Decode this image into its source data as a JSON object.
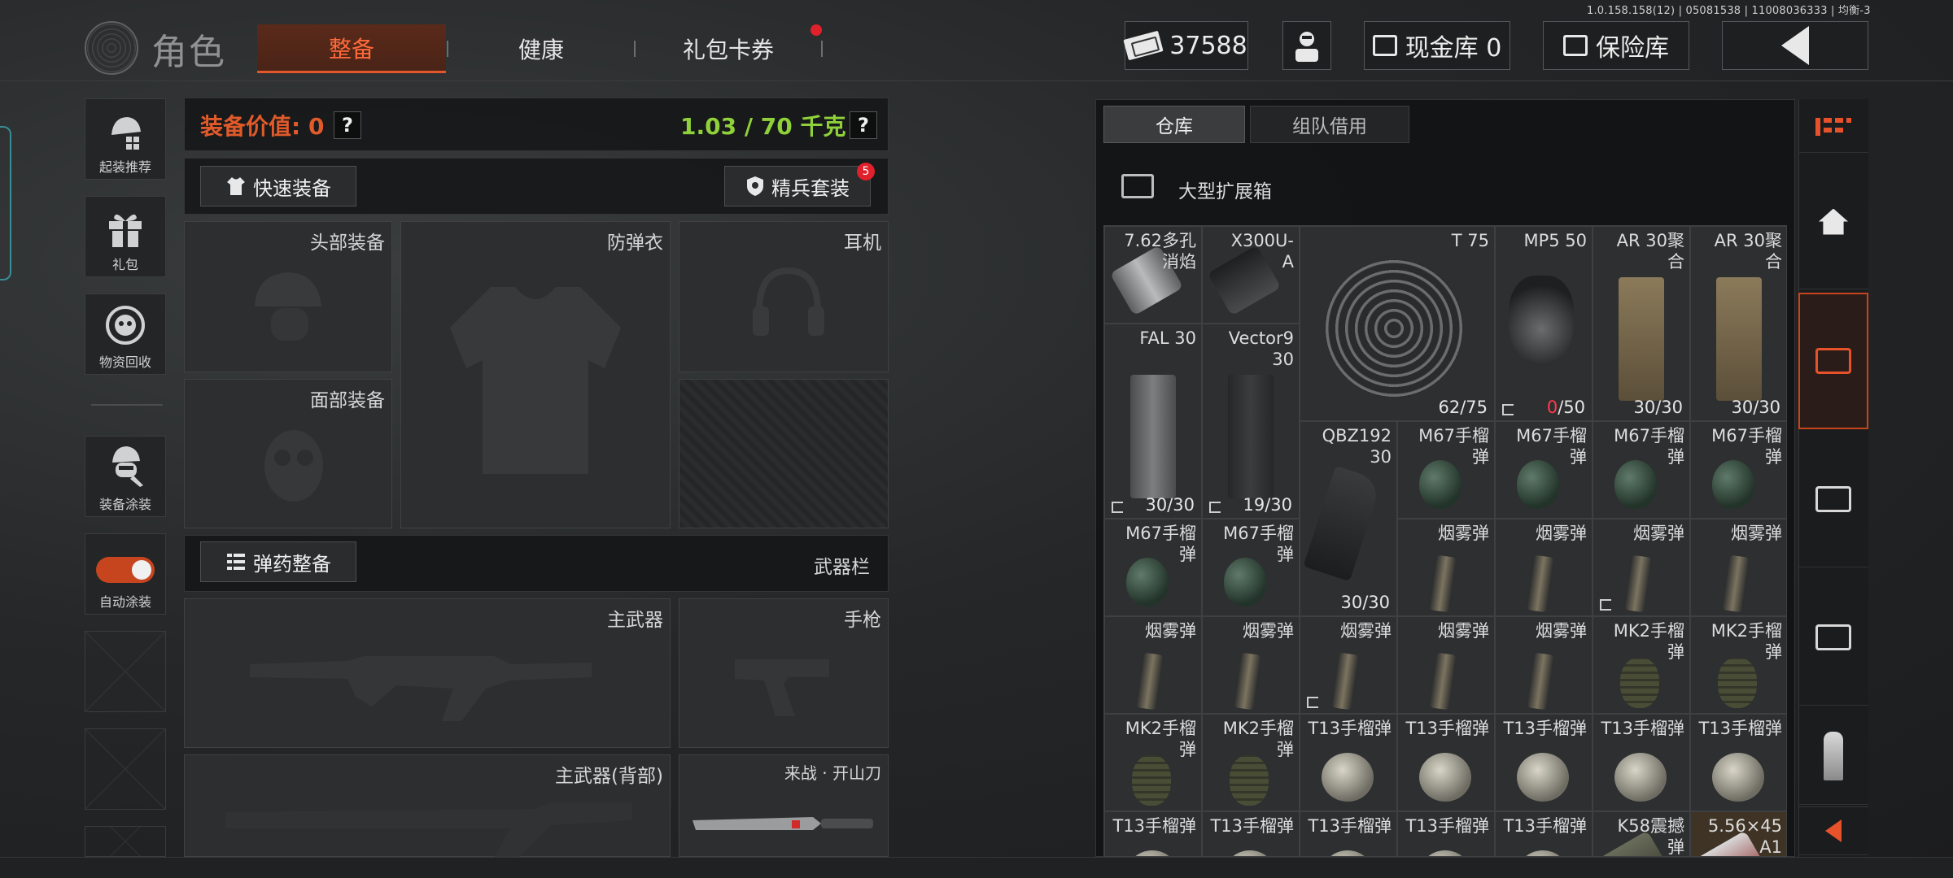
{
  "version": "1.0.158.158(12) | 05081538 | 11008036333 | 均衡-3",
  "header": {
    "title": "角色",
    "tabs": [
      {
        "label": "整备",
        "active": true
      },
      {
        "label": "健康",
        "active": false
      },
      {
        "label": "礼包卡券",
        "active": false,
        "has_notification": true
      }
    ],
    "money": "37588",
    "cash_vault": "现金库 0",
    "insurance": "保险库"
  },
  "sidebar": {
    "items": [
      {
        "label": "起装推荐",
        "icon": "helmet-grid-icon"
      },
      {
        "label": "礼包",
        "icon": "gift-icon"
      },
      {
        "label": "物资回收",
        "icon": "recycle-icon"
      },
      {
        "label": "装备涂装",
        "icon": "soldier-paint-icon"
      },
      {
        "label": "自动涂装",
        "icon": "toggle-icon",
        "toggle_on": true
      }
    ]
  },
  "equipment": {
    "value_label": "装备价值: 0",
    "weight": "1.03 / 70 千克",
    "help_symbol": "?",
    "quick_equip": "快速装备",
    "elite_set": "精兵套装",
    "elite_badge": "5",
    "slots": {
      "head": "头部装备",
      "armor": "防弹衣",
      "headset": "耳机",
      "face": "面部装备",
      "primary": "主武器",
      "pistol": "手枪",
      "primary_back": "主武器(背部)",
      "melee": "来战 · 开山刀"
    },
    "ammo_button": "弹药整备",
    "weapon_bar": "武器栏"
  },
  "storage": {
    "tabs": [
      {
        "label": "仓库",
        "active": true
      },
      {
        "label": "组队借用",
        "active": false
      }
    ],
    "container": "大型扩展箱",
    "items": [
      {
        "name": "7.62多孔\n消焰",
        "art": "muzzle",
        "col": 0,
        "row": 0,
        "w": 1,
        "h": 1
      },
      {
        "name": "X300U-\nA",
        "art": "light",
        "col": 1,
        "row": 0,
        "w": 1,
        "h": 1
      },
      {
        "name": "T 75",
        "count": "62/75",
        "art": "drum",
        "col": 2,
        "row": 0,
        "w": 2,
        "h": 2
      },
      {
        "name": "MP5 50",
        "count_red": "0",
        "count_rest": "/50",
        "flag": true,
        "art": "drum-small",
        "col": 4,
        "row": 0,
        "w": 1,
        "h": 2
      },
      {
        "name": "AR 30聚\n合",
        "count": "30/30",
        "art": "mag-tan",
        "col": 5,
        "row": 0,
        "w": 1,
        "h": 2
      },
      {
        "name": "AR 30聚\n合",
        "count": "30/30",
        "art": "mag-tan",
        "col": 6,
        "row": 0,
        "w": 1,
        "h": 2
      },
      {
        "name": "FAL 30",
        "count": "30/30",
        "flag": true,
        "art": "mag-steel",
        "col": 0,
        "row": 1,
        "w": 1,
        "h": 2
      },
      {
        "name": "Vector9\n30",
        "count": "19/30",
        "flag": true,
        "art": "mag-dark",
        "col": 1,
        "row": 1,
        "w": 1,
        "h": 2
      },
      {
        "name": "QBZ192\n30",
        "count": "30/30",
        "art": "mag-curve",
        "col": 2,
        "row": 2,
        "w": 1,
        "h": 2
      },
      {
        "name": "M67手榴\n弹",
        "art": "grenade",
        "col": 3,
        "row": 2,
        "w": 1,
        "h": 1
      },
      {
        "name": "M67手榴\n弹",
        "art": "grenade",
        "col": 4,
        "row": 2,
        "w": 1,
        "h": 1
      },
      {
        "name": "M67手榴\n弹",
        "art": "grenade",
        "col": 5,
        "row": 2,
        "w": 1,
        "h": 1
      },
      {
        "name": "M67手榴\n弹",
        "art": "grenade",
        "col": 6,
        "row": 2,
        "w": 1,
        "h": 1
      },
      {
        "name": "M67手榴\n弹",
        "art": "grenade",
        "col": 0,
        "row": 3,
        "w": 1,
        "h": 1
      },
      {
        "name": "M67手榴\n弹",
        "art": "grenade",
        "col": 1,
        "row": 3,
        "w": 1,
        "h": 1
      },
      {
        "name": "烟雾弹",
        "art": "smoke",
        "col": 3,
        "row": 3,
        "w": 1,
        "h": 1
      },
      {
        "name": "烟雾弹",
        "art": "smoke",
        "col": 4,
        "row": 3,
        "w": 1,
        "h": 1
      },
      {
        "name": "烟雾弹",
        "flag": true,
        "art": "smoke",
        "col": 5,
        "row": 3,
        "w": 1,
        "h": 1
      },
      {
        "name": "烟雾弹",
        "art": "smoke",
        "col": 6,
        "row": 3,
        "w": 1,
        "h": 1
      },
      {
        "name": "烟雾弹",
        "art": "smoke",
        "col": 0,
        "row": 4,
        "w": 1,
        "h": 1
      },
      {
        "name": "烟雾弹",
        "art": "smoke",
        "col": 1,
        "row": 4,
        "w": 1,
        "h": 1
      },
      {
        "name": "烟雾弹",
        "flag": true,
        "art": "smoke",
        "col": 2,
        "row": 4,
        "w": 1,
        "h": 1
      },
      {
        "name": "烟雾弹",
        "art": "smoke",
        "col": 3,
        "row": 4,
        "w": 1,
        "h": 1
      },
      {
        "name": "烟雾弹",
        "art": "smoke",
        "col": 4,
        "row": 4,
        "w": 1,
        "h": 1
      },
      {
        "name": "MK2手榴\n弹",
        "art": "mk2",
        "col": 5,
        "row": 4,
        "w": 1,
        "h": 1
      },
      {
        "name": "MK2手榴\n弹",
        "art": "mk2",
        "col": 6,
        "row": 4,
        "w": 1,
        "h": 1
      },
      {
        "name": "MK2手榴\n弹",
        "art": "mk2",
        "col": 0,
        "row": 5,
        "w": 1,
        "h": 1
      },
      {
        "name": "MK2手榴\n弹",
        "art": "mk2",
        "col": 1,
        "row": 5,
        "w": 1,
        "h": 1
      },
      {
        "name": "T13手榴弹",
        "art": "t13",
        "col": 2,
        "row": 5,
        "w": 1,
        "h": 1
      },
      {
        "name": "T13手榴弹",
        "art": "t13",
        "col": 3,
        "row": 5,
        "w": 1,
        "h": 1
      },
      {
        "name": "T13手榴弹",
        "art": "t13",
        "col": 4,
        "row": 5,
        "w": 1,
        "h": 1
      },
      {
        "name": "T13手榴弹",
        "art": "t13",
        "col": 5,
        "row": 5,
        "w": 1,
        "h": 1
      },
      {
        "name": "T13手榴弹",
        "art": "t13",
        "col": 6,
        "row": 5,
        "w": 1,
        "h": 1
      },
      {
        "name": "T13手榴弹",
        "art": "t13",
        "col": 0,
        "row": 6,
        "w": 1,
        "h": 1
      },
      {
        "name": "T13手榴弹",
        "art": "t13",
        "col": 1,
        "row": 6,
        "w": 1,
        "h": 1
      },
      {
        "name": "T13手榴弹",
        "art": "t13",
        "col": 2,
        "row": 6,
        "w": 1,
        "h": 1
      },
      {
        "name": "T13手榴弹",
        "art": "t13",
        "col": 3,
        "row": 6,
        "w": 1,
        "h": 1
      },
      {
        "name": "T13手榴弹",
        "art": "t13",
        "col": 4,
        "row": 6,
        "w": 1,
        "h": 1
      },
      {
        "name": "K58震撼\n弹",
        "art": "stun",
        "col": 5,
        "row": 6,
        "w": 1,
        "h": 1
      },
      {
        "name": "5.56×45\nA1",
        "art": "ammo-box",
        "highlight": true,
        "col": 6,
        "row": 6,
        "w": 1,
        "h": 1
      }
    ]
  },
  "rail": {
    "items": [
      "dash-menu-icon",
      "home-icon",
      "storage-chest-icon",
      "chest-icon",
      "chest-icon",
      "ammo-icon",
      "collapse-icon"
    ]
  },
  "colors": {
    "accent": "#e2562a",
    "weight_green": "#8fd13a",
    "badge_red": "#e0202a"
  }
}
